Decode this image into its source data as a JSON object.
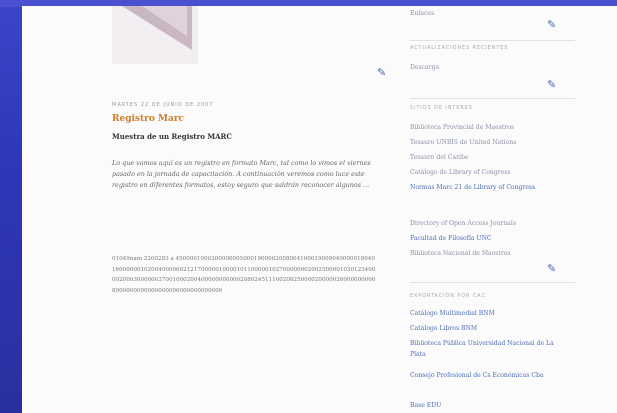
{
  "post": {
    "date": "MARTES 22 DE JUNIO DE 2007",
    "title": "Registro Marc",
    "subtitle": "Muestra de un Registro MARC",
    "intro": "Lo que vamos aquí es un registro en formato Marc, tal como lo vimos el viernes pasado en la jornada de capacitación. A continuación veremos como luce este registro en diferentes formatos, estoy seguro que saldrán reconocer algunos ...",
    "code": "01049nam 2200283 a 4500001000200000005000190000200800410001900904000001804016000000102004000060212170000010000101100000102700000002002500001030123400002000300000037001000200400000000000208024511100206250000200000260000000008000000000000000006000000000000"
  },
  "sidebar": {
    "top_link": "Enlaces",
    "sections": [
      {
        "title": "ACTUALIZACIONES RECIENTES",
        "links": [
          "Descarga"
        ]
      },
      {
        "title": "SITIOS DE INTERES",
        "links": [
          "Biblioteca Provincial de Maestros",
          "Tesauro UNBIS de United Nations",
          "Tesauro del Caribe",
          "Catálogo de Library of Congress",
          "Normas Marc 21 de Library of Congress",
          "Directory of Open Access Journals",
          "Facultad de Filosofía UNC",
          "Biblioteca Nacional de Maestros"
        ]
      },
      {
        "title": "EXPORTACIÓN POR CAC",
        "links": [
          "Catálogo Multimedial BNM",
          "Catálogo Libros BNM",
          "Biblioteca Pública Universidad Nacional de La Plata",
          "Consejo Profesional de Cs Económicas Cba",
          "Base EDU"
        ]
      }
    ]
  }
}
